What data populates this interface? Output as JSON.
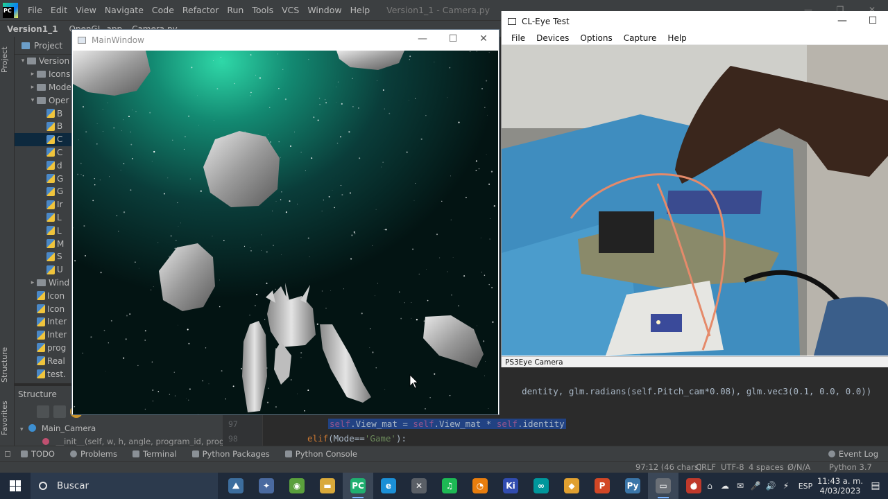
{
  "ide": {
    "logo": "PC",
    "menu": [
      "File",
      "Edit",
      "View",
      "Navigate",
      "Code",
      "Refactor",
      "Run",
      "Tools",
      "VCS",
      "Window",
      "Help"
    ],
    "title": "Version1_1 - Camera.py",
    "navbar": {
      "project": "Version1_1",
      "folder": "OpenGL_app",
      "file": "Camera.py"
    },
    "left_tabs": {
      "project": "Project",
      "structure": "Structure",
      "favorites": "Favorites"
    },
    "project_panel": {
      "title": "Project",
      "items": [
        {
          "label": "Version",
          "type": "folder",
          "arrow": "▾"
        },
        {
          "label": "Icons",
          "type": "folder",
          "arrow": "▸"
        },
        {
          "label": "Mode",
          "type": "folder",
          "arrow": "▸"
        },
        {
          "label": "Oper",
          "type": "folder",
          "arrow": "▾"
        },
        {
          "label": "B",
          "type": "file"
        },
        {
          "label": "B",
          "type": "file"
        },
        {
          "label": "C",
          "type": "file",
          "selected": true
        },
        {
          "label": "C",
          "type": "file"
        },
        {
          "label": "d",
          "type": "file"
        },
        {
          "label": "G",
          "type": "file"
        },
        {
          "label": "G",
          "type": "file"
        },
        {
          "label": "Ir",
          "type": "file"
        },
        {
          "label": "L",
          "type": "file"
        },
        {
          "label": "L",
          "type": "file"
        },
        {
          "label": "M",
          "type": "file"
        },
        {
          "label": "S",
          "type": "file"
        },
        {
          "label": "U",
          "type": "file"
        },
        {
          "label": "Wind",
          "type": "folder",
          "arrow": "▸"
        },
        {
          "label": "Icon",
          "type": "file"
        },
        {
          "label": "Icon",
          "type": "file"
        },
        {
          "label": "Inter",
          "type": "file"
        },
        {
          "label": "Inter",
          "type": "file"
        },
        {
          "label": "prog",
          "type": "file"
        },
        {
          "label": "Real",
          "type": "file"
        },
        {
          "label": "test.",
          "type": "file"
        }
      ]
    },
    "structure": {
      "title": "Structure",
      "class_name": "Main_Camera",
      "method": "__init__(self, w, h, angle, program_id, program_id"
    },
    "editor": {
      "lines": [
        {
          "num": "97"
        },
        {
          "num": "98"
        }
      ],
      "partial_line": "dentity, glm.radians(self.Pitch_cam*0.08), glm.vec3(0.1, 0.0, 0.0))"
    },
    "bottom_tabs": [
      "TODO",
      "Problems",
      "Terminal",
      "Python Packages",
      "Python Console"
    ],
    "event_log": "Event Log",
    "status": {
      "position": "97:12 (46 chars)",
      "line_sep": "CRLF",
      "encoding": "UTF-8",
      "indent": "4 spaces",
      "readonly": "Ø/N/A",
      "python": "Python 3.7"
    }
  },
  "main_window": {
    "title": "MainWindow"
  },
  "cl_eye": {
    "title": "CL-Eye Test",
    "menu": [
      "File",
      "Devices",
      "Options",
      "Capture",
      "Help"
    ],
    "status": "PS3Eye Camera"
  },
  "taskbar": {
    "search_label": "Buscar",
    "apps": [
      {
        "name": "widget",
        "glyph": "⛰",
        "color": "#3d6e9e"
      },
      {
        "name": "task-view",
        "glyph": "✦",
        "color": "#4a6aa0"
      },
      {
        "name": "chat",
        "glyph": "◉",
        "color": "#5aa03c"
      },
      {
        "name": "explorer",
        "glyph": "▬",
        "color": "#d9a93a"
      },
      {
        "name": "pycharm",
        "glyph": "PC",
        "color": "#20b070",
        "active": true
      },
      {
        "name": "edge",
        "glyph": "e",
        "color": "#1b8fd6"
      },
      {
        "name": "app-x",
        "glyph": "✕",
        "color": "#5a5f66"
      },
      {
        "name": "spotify",
        "glyph": "♫",
        "color": "#1db954"
      },
      {
        "name": "blender",
        "glyph": "◔",
        "color": "#e87d0d"
      },
      {
        "name": "kicad",
        "glyph": "Ki",
        "color": "#314cb0"
      },
      {
        "name": "arduino",
        "glyph": "∞",
        "color": "#00979c"
      },
      {
        "name": "git",
        "glyph": "◆",
        "color": "#e0a030"
      },
      {
        "name": "powerpoint",
        "glyph": "P",
        "color": "#d24726"
      },
      {
        "name": "python",
        "glyph": "Py",
        "color": "#3a75a8"
      },
      {
        "name": "app-window",
        "glyph": "▭",
        "color": "#6a6f76",
        "active": true
      },
      {
        "name": "recorder",
        "glyph": "●",
        "color": "#c0392b"
      }
    ],
    "tray_icons": [
      "^",
      "⌂",
      "☁",
      "✉",
      "🎤",
      "🔊",
      "⚡"
    ],
    "language": "ESP",
    "time": "11:43 a. m.",
    "date": "4/03/2023"
  }
}
